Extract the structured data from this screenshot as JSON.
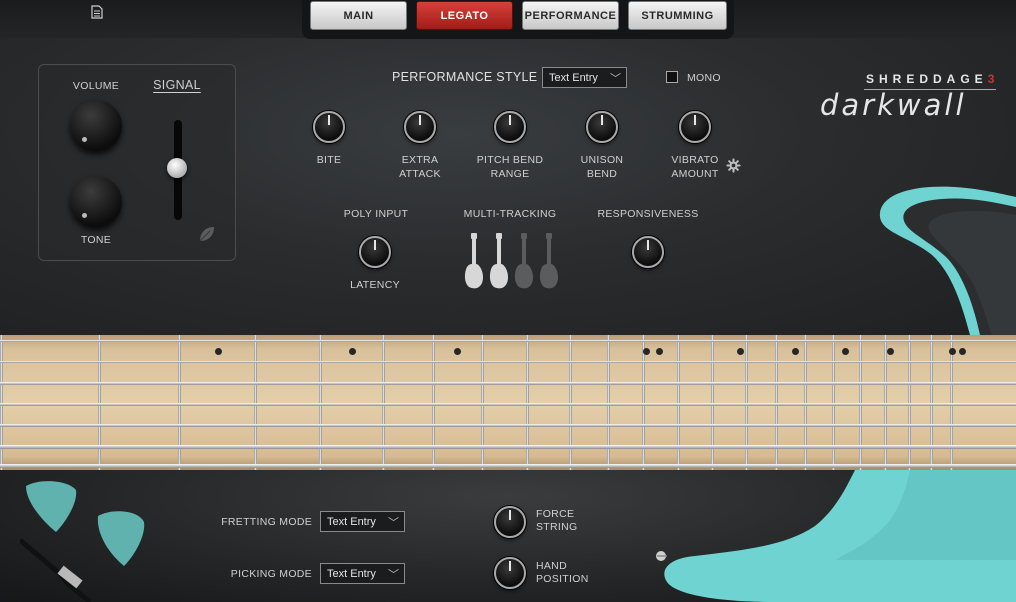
{
  "header": {
    "tabs": [
      {
        "label": "MAIN",
        "active": false
      },
      {
        "label": "LEGATO",
        "active": true
      },
      {
        "label": "PERFORMANCE",
        "active": false
      },
      {
        "label": "STRUMMING",
        "active": false
      }
    ]
  },
  "signal_panel": {
    "volume_label": "VOLUME",
    "signal_label": "SIGNAL",
    "tone_label": "TONE"
  },
  "performance": {
    "style_label": "PERFORMANCE STYLE",
    "style_value": "Text Entry",
    "mono_label": "MONO",
    "mono_checked": false,
    "knobs": [
      {
        "label_1": "BITE",
        "label_2": ""
      },
      {
        "label_1": "EXTRA",
        "label_2": "ATTACK"
      },
      {
        "label_1": "PITCH BEND",
        "label_2": "RANGE"
      },
      {
        "label_1": "UNISON",
        "label_2": "BEND"
      },
      {
        "label_1": "VIBRATO",
        "label_2": "AMOUNT"
      }
    ],
    "poly_input_label": "POLY INPUT",
    "latency_label": "LATENCY",
    "multi_tracking_label": "MULTI-TRACKING",
    "multi_tracking_active": 2,
    "responsiveness_label": "RESPONSIVENESS"
  },
  "brand": {
    "top": "SHREDDAGE",
    "top_num": "3",
    "main": "darkwall"
  },
  "bottom": {
    "fretting_mode_label": "FRETTING MODE",
    "fretting_mode_value": "Text Entry",
    "picking_mode_label": "PICKING MODE",
    "picking_mode_value": "Text Entry",
    "force_string_1": "FORCE",
    "force_string_2": "STRING",
    "hand_position_1": "HAND",
    "hand_position_2": "POSITION"
  },
  "colors": {
    "accent_red": "#b8302a",
    "guitar_body": "#6fd3d1"
  }
}
